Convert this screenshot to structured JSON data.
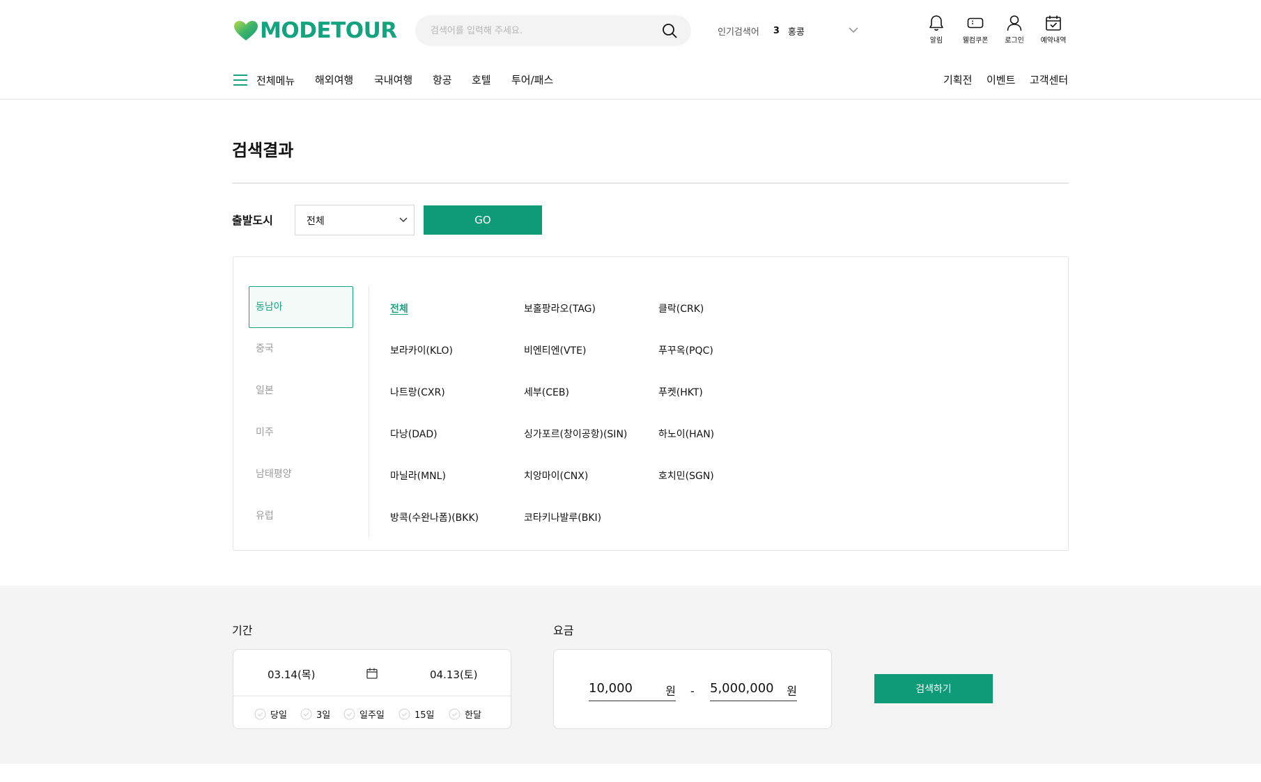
{
  "header": {
    "logo_text": "MODETOUR",
    "search_placeholder": "검색어를 입력해 주세요.",
    "popular_label": "인기검색어",
    "popular_rank": "3",
    "popular_word": "홍콩",
    "utils": {
      "alarm": "알림",
      "coupon": "웰컴쿠폰",
      "login": "로그인",
      "reservation": "예약내역"
    }
  },
  "gnb": {
    "all_menu": "전체메뉴",
    "items": [
      "해외여행",
      "국내여행",
      "항공",
      "호텔",
      "투어/패스"
    ],
    "right_items": [
      "기획전",
      "이벤트",
      "고객센터"
    ]
  },
  "page": {
    "title": "검색결과"
  },
  "departure": {
    "label": "출발도시",
    "selected": "전체",
    "go_label": "GO"
  },
  "regions": {
    "tabs": [
      "동남아",
      "중국",
      "일본",
      "미주",
      "남태평양",
      "유럽"
    ],
    "active_tab": "동남아",
    "cities": [
      [
        "전체",
        "보라카이(KLO)",
        "나트랑(CXR)",
        "다낭(DAD)",
        "마닐라(MNL)",
        "방콕(수완나폼)(BKK)"
      ],
      [
        "보홀팡라오(TAG)",
        "비엔티엔(VTE)",
        "세부(CEB)",
        "싱가포르(창이공항)(SIN)",
        "치앙마이(CNX)",
        "코타키나발루(BKI)"
      ],
      [
        "클락(CRK)",
        "푸꾸옥(PQC)",
        "푸켓(HKT)",
        "하노이(HAN)",
        "호치민(SGN)"
      ]
    ],
    "selected_city": "전체"
  },
  "filter": {
    "period_label": "기간",
    "date_start": "03.14(목)",
    "date_end": "04.13(토)",
    "durations": [
      "당일",
      "3일",
      "일주일",
      "15일",
      "한달"
    ],
    "price_label": "요금",
    "price_min": "10,000",
    "price_max": "5,000,000",
    "price_unit": "원",
    "price_separator": "-",
    "search_label": "검색하기"
  },
  "colors": {
    "brand": "#14a37f",
    "button": "#0f9b78",
    "band_bg": "#f4f4f4"
  }
}
